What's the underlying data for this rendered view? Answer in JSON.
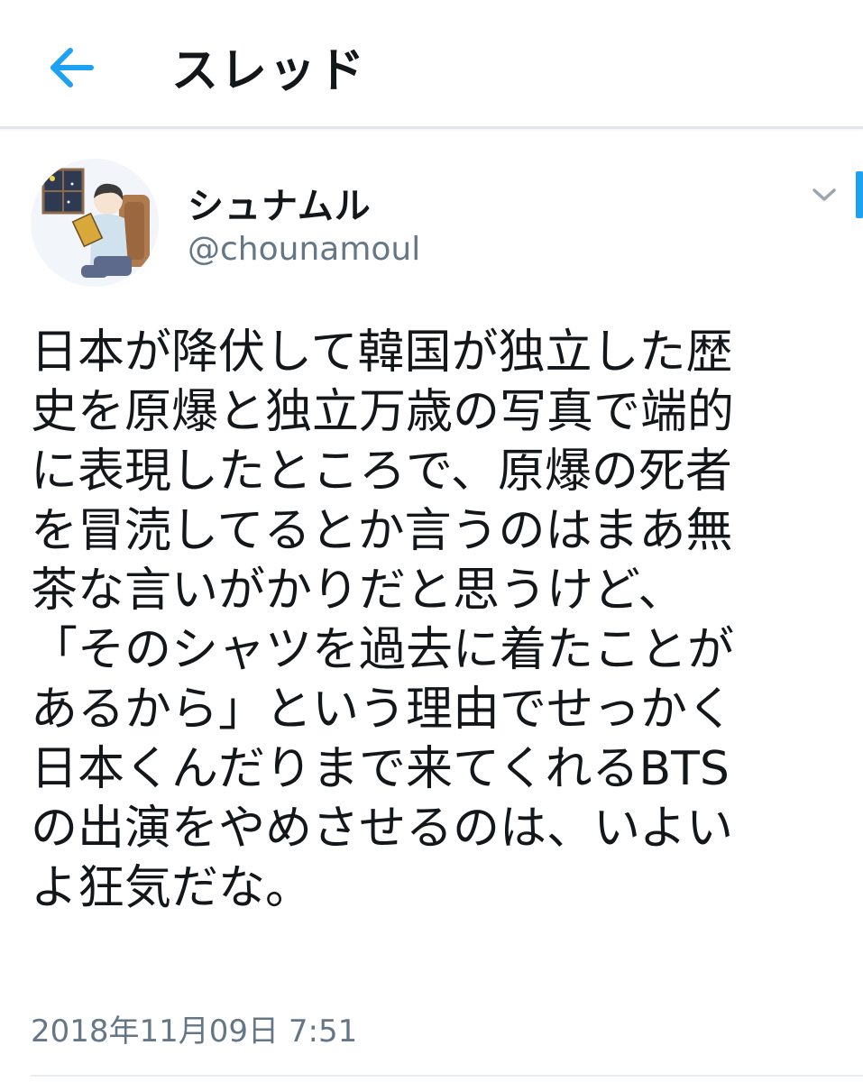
{
  "header": {
    "back_icon": "arrow-left-icon",
    "title": "スレッド"
  },
  "tweet": {
    "avatar_icon": "avatar-illustration",
    "display_name": "シュナムル",
    "handle": "@chounamoul",
    "menu_icon": "chevron-down-icon",
    "text_lines": [
      "日本が降伏して韓国が独立した歴",
      "史を原爆と独立万歳の写真で端的",
      "に表現したところで、原爆の死者",
      "を冒涜してるとか言うのはまあ無",
      "茶な言いがかりだと思うけど、",
      "「そのシャツを過去に着たことが",
      "あるから」という理由でせっかく",
      "日本くんだりまで来てくれるBTS",
      "の出演をやめさせるのは、いよい",
      "よ狂気だな。"
    ],
    "timestamp": "2018年11月09日 7:51"
  },
  "colors": {
    "accent": "#1da1f2",
    "text": "#14171a",
    "secondary": "#657786",
    "divider": "#e6ecf0"
  }
}
